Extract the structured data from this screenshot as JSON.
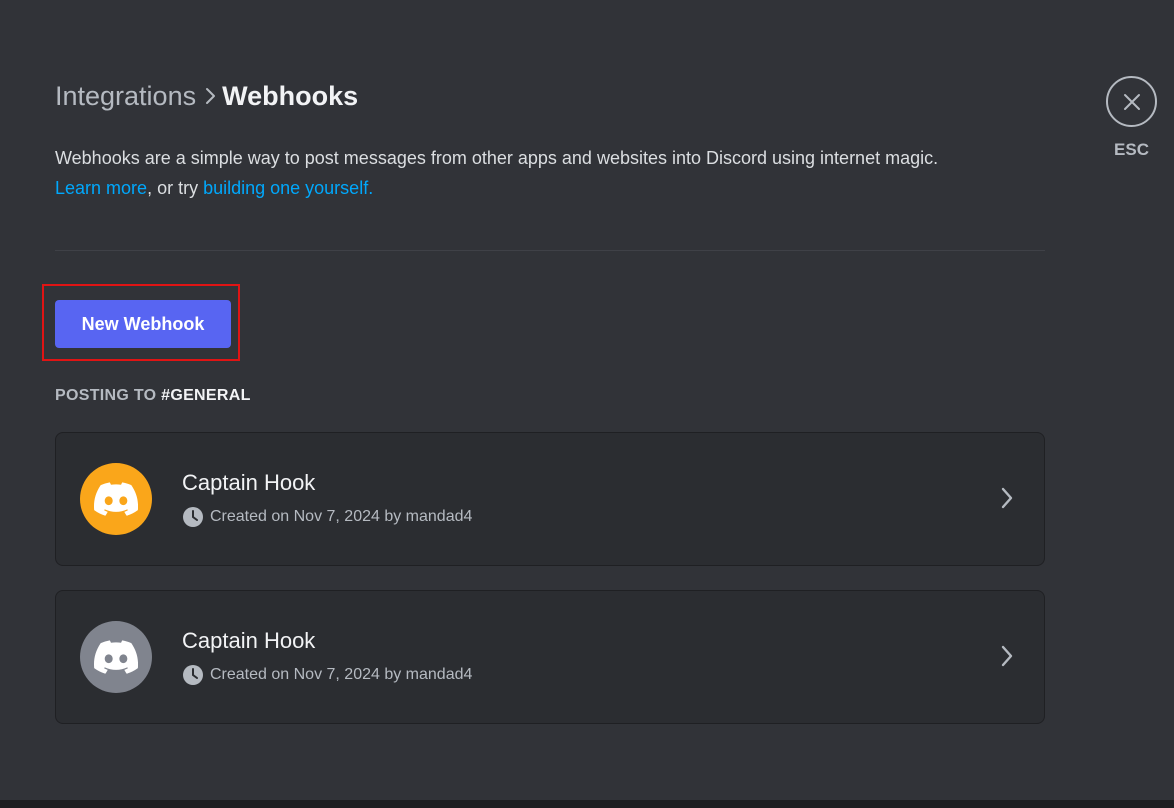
{
  "breadcrumb": {
    "parent": "Integrations",
    "current": "Webhooks"
  },
  "description": {
    "text": "Webhooks are a simple way to post messages from other apps and websites into Discord using internet magic.",
    "learn_more": "Learn more",
    "middle": ", or try ",
    "build_link": "building one yourself."
  },
  "actions": {
    "new_webhook_label": "New Webhook"
  },
  "section": {
    "prefix": "POSTING TO ",
    "channel": "#GENERAL"
  },
  "webhooks": [
    {
      "name": "Captain Hook",
      "meta": "Created on Nov 7, 2024 by mandad4",
      "avatar_color": "#faa61a",
      "avatar_icon": "discord-logo-icon"
    },
    {
      "name": "Captain Hook",
      "meta": "Created on Nov 7, 2024 by mandad4",
      "avatar_color": "#80848e",
      "avatar_icon": "discord-logo-icon"
    }
  ],
  "close": {
    "label": "ESC",
    "icon": "close-icon"
  },
  "colors": {
    "background": "#313338",
    "card": "#2b2d31",
    "brand": "#5865f2",
    "link": "#00a8fc",
    "highlight": "#e01414"
  }
}
